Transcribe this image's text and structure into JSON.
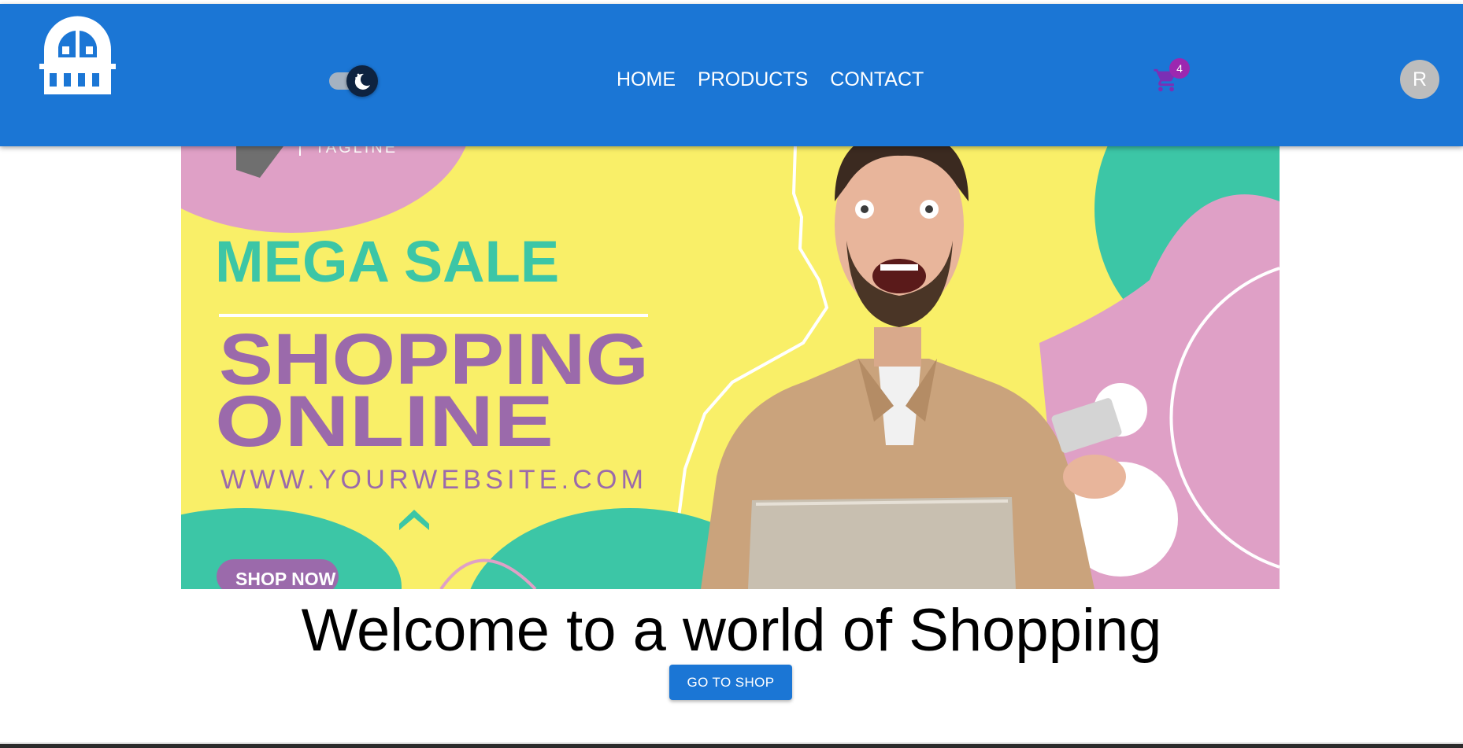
{
  "header": {
    "logo_icon": "storefront-icon",
    "theme_toggle_icon": "moon-icon",
    "nav": [
      {
        "label": "HOME"
      },
      {
        "label": "PRODUCTS"
      },
      {
        "label": "CONTACT"
      }
    ],
    "cart_icon": "shopping-cart-icon",
    "cart_count": "4",
    "avatar_letter": "R"
  },
  "banner": {
    "top_text": "TAGLINE",
    "headline": "MEGA SALE",
    "title_line1": "SHOPPING",
    "title_line2": "ONLINE",
    "website": "WWW.YOURWEBSITE.COM",
    "cta": "SHOP NOW"
  },
  "main": {
    "welcome": "Welcome to a world of Shopping",
    "shop_button": "GO TO SHOP"
  },
  "colors": {
    "appbar": "#1b76d5",
    "badge": "#9c27b0",
    "banner_yellow": "#f9ef68",
    "banner_teal": "#3cc6a6",
    "banner_pink": "#dfa0c6",
    "banner_purple": "#9b6aab"
  }
}
